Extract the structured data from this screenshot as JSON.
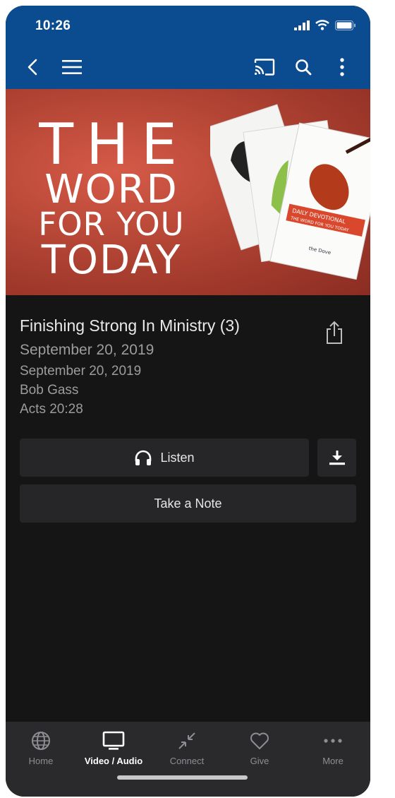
{
  "status_bar": {
    "time": "10:26"
  },
  "app_bar": {
    "icons": [
      "back-icon",
      "menu-icon",
      "cast-icon",
      "search-icon",
      "more-vert-icon"
    ]
  },
  "hero": {
    "lines": [
      "THE",
      "WORD",
      "FOR YOU",
      "TODAY"
    ],
    "card_labels": {
      "label1": "DAILY DEVOTIONAL",
      "label2": "THE WORD FOR YOU TODAY",
      "brand": "the Dove"
    }
  },
  "episode": {
    "title": "Finishing Strong In Ministry (3)",
    "date_primary": "September 20, 2019",
    "date_secondary": "September 20, 2019",
    "author": "Bob Gass",
    "reference": "Acts 20:28"
  },
  "actions": {
    "listen_label": "Listen",
    "note_label": "Take a Note"
  },
  "tab_bar": {
    "items": [
      {
        "label": "Home",
        "icon": "globe-icon"
      },
      {
        "label": "Video / Audio",
        "icon": "tv-icon"
      },
      {
        "label": "Connect",
        "icon": "connect-icon"
      },
      {
        "label": "Give",
        "icon": "heart-icon"
      },
      {
        "label": "More",
        "icon": "more-horiz-icon"
      }
    ],
    "active_index": 1
  },
  "colors": {
    "app_bar": "#0b4b8f",
    "background": "#151516",
    "button": "#262628",
    "tab_bar": "#2a2a2c",
    "hero_red": "#b24434"
  }
}
